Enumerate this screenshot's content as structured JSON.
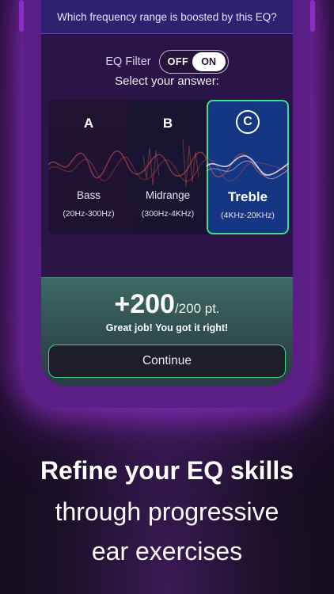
{
  "question": "Which frequency range is boosted by this EQ?",
  "eq_filter": {
    "label": "EQ Filter",
    "off": "OFF",
    "on": "ON"
  },
  "select_title": "Select your answer:",
  "options": [
    {
      "letter": "A",
      "name": "Bass",
      "range": "(20Hz-300Hz)"
    },
    {
      "letter": "B",
      "name": "Midrange",
      "range": "(300Hz-4KHz)"
    },
    {
      "letter": "C",
      "name": "Treble",
      "range": "(4KHz-20KHz)"
    }
  ],
  "result": {
    "points": "+200",
    "total": "/200 pt.",
    "message": "Great job! You got it right!"
  },
  "continue_label": "Continue",
  "headline": {
    "line1": "Refine your EQ skills",
    "line2": "through progressive",
    "line3": "ear exercises"
  },
  "colors": {
    "accent_green": "#3de08a",
    "selected_blue": "#143e96",
    "phone_purple": "#5a1e86"
  }
}
